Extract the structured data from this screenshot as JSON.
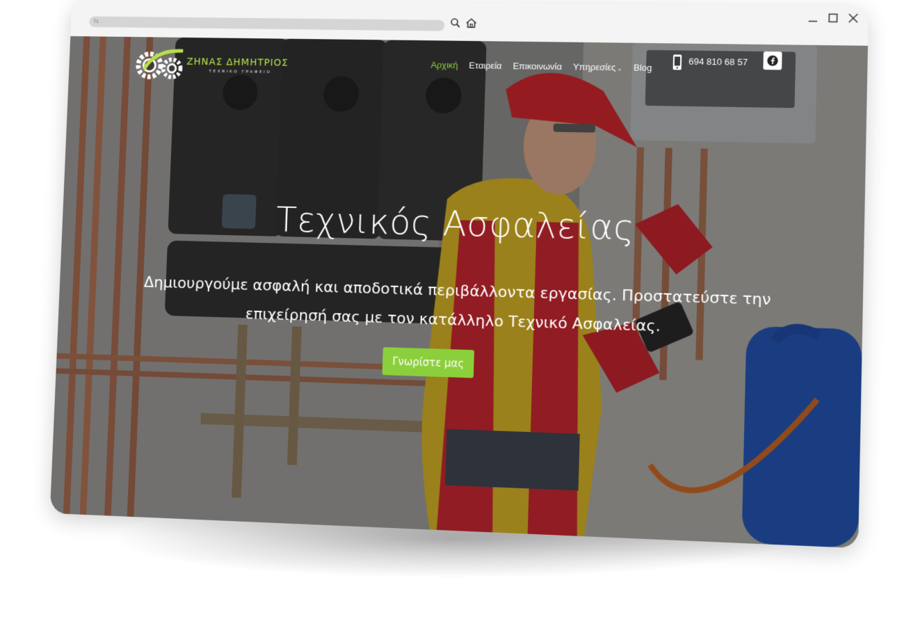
{
  "browser": {
    "icons": [
      "search-icon",
      "home-icon",
      "minimize-icon",
      "maximize-icon",
      "close-icon",
      "url-tune-icon"
    ]
  },
  "site": {
    "logo": {
      "name": "ΖΗΝΑΣ ΔΗΜΗΤΡΙΟΣ",
      "tagline": "ΤΕΧΝΙΚΟ ΓΡΑΦΕΙΟ"
    },
    "nav": {
      "home": "Αρχική",
      "company": "Εταιρεία",
      "contact": "Επικοινωνία",
      "services": "Υπηρεσίες",
      "blog": "Blog"
    },
    "phone": "694 810 68 57",
    "colors": {
      "accent": "#8ccf3c",
      "logo_green": "#b8e04a"
    }
  },
  "hero": {
    "title": "Τεχνικός Ασφαλείας",
    "text": "Δημιουργούμε ασφαλή και αποδοτικά περιβάλλοντα εργασίας. Προστατεύστε την επιχείρησή σας με τον κατάλληλο Τεχνικό Ασφαλείας.",
    "cta": "Γνωρίστε μας"
  }
}
